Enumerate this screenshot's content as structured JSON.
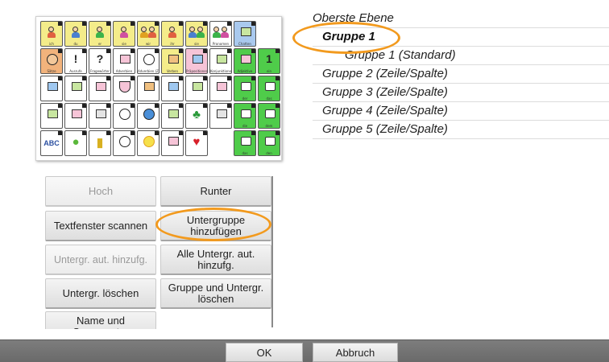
{
  "grid": {
    "rows": [
      [
        {
          "label": "ich",
          "color": "yellow",
          "icon": "person-icon"
        },
        {
          "label": "du",
          "color": "yellow",
          "icon": "person-pointing-icon"
        },
        {
          "label": "er",
          "color": "yellow",
          "icon": "boy-icon"
        },
        {
          "label": "sie",
          "color": "yellow",
          "icon": "girl-icon"
        },
        {
          "label": "wir",
          "color": "yellow",
          "icon": "group-icon"
        },
        {
          "label": "ihr",
          "color": "yellow",
          "icon": "pair-icon"
        },
        {
          "label": "sie",
          "color": "yellow",
          "icon": "people-icon"
        },
        {
          "label": "Pronomen",
          "color": "white",
          "icon": "people-group-icon"
        },
        {
          "label": "Chatten",
          "color": "blue",
          "icon": "speech-icon"
        },
        {
          "label": "",
          "color": "none",
          "icon": ""
        }
      ],
      [
        {
          "label": "Sätze",
          "color": "orange",
          "icon": "face-icon"
        },
        {
          "label": "Ausrufe",
          "color": "white",
          "icon": "exclamation-icon"
        },
        {
          "label": "Fragewörter",
          "color": "white",
          "icon": "question-icon"
        },
        {
          "label": "Adverbien",
          "color": "white",
          "icon": "tools-icon"
        },
        {
          "label": "Adverbien (Zeit)",
          "color": "white",
          "icon": "clock-icon"
        },
        {
          "label": "Verben",
          "color": "yellow",
          "icon": "action-icon"
        },
        {
          "label": "Präpositionen",
          "color": "pink",
          "icon": "box-icon"
        },
        {
          "label": "Konjunktionen",
          "color": "white",
          "icon": "magnet-icon"
        },
        {
          "label": "Adjektive",
          "color": "green",
          "icon": "adjective-icon"
        },
        {
          "label": "ein",
          "color": "green",
          "icon": "number-one-icon"
        }
      ],
      [
        {
          "label": "",
          "color": "white",
          "icon": "calendar-icon"
        },
        {
          "label": "",
          "color": "white",
          "icon": "bricks-icon"
        },
        {
          "label": "",
          "color": "white",
          "icon": "house-icon"
        },
        {
          "label": "",
          "color": "white",
          "icon": "bowl-icon"
        },
        {
          "label": "",
          "color": "white",
          "icon": "tv-icon"
        },
        {
          "label": "",
          "color": "white",
          "icon": "music-icon"
        },
        {
          "label": "",
          "color": "white",
          "icon": "nose-icon"
        },
        {
          "label": "",
          "color": "white",
          "icon": "toilet-icon"
        },
        {
          "label": "der",
          "color": "green",
          "icon": "article-icon"
        },
        {
          "label": "das",
          "color": "green",
          "icon": "article-icon"
        }
      ],
      [
        {
          "label": "",
          "color": "white",
          "icon": "dog-icon"
        },
        {
          "label": "",
          "color": "white",
          "icon": "car-icon"
        },
        {
          "label": "",
          "color": "white",
          "icon": "family-icon"
        },
        {
          "label": "",
          "color": "white",
          "icon": "clock-icon"
        },
        {
          "label": "",
          "color": "white",
          "icon": "globe-icon"
        },
        {
          "label": "",
          "color": "white",
          "icon": "puzzle-icon"
        },
        {
          "label": "",
          "color": "white",
          "icon": "tree-icon"
        },
        {
          "label": "",
          "color": "white",
          "icon": "clothes-icon"
        },
        {
          "label": "die",
          "color": "green",
          "icon": "article-icon"
        },
        {
          "label": "dem",
          "color": "green",
          "icon": "article-icon"
        }
      ],
      [
        {
          "label": "ABC",
          "color": "white",
          "icon": "abc-icon"
        },
        {
          "label": "",
          "color": "white",
          "icon": "apple-icon"
        },
        {
          "label": "",
          "color": "white",
          "icon": "bottle-icon"
        },
        {
          "label": "",
          "color": "white",
          "icon": "ball-icon"
        },
        {
          "label": "",
          "color": "white",
          "icon": "sun-icon"
        },
        {
          "label": "",
          "color": "white",
          "icon": "money-icon"
        },
        {
          "label": "",
          "color": "white",
          "icon": "heart-icon"
        },
        {
          "label": "",
          "color": "none",
          "icon": ""
        },
        {
          "label": "das",
          "color": "green",
          "icon": "article-icon"
        },
        {
          "label": "den",
          "color": "green",
          "icon": "article-icon"
        }
      ]
    ]
  },
  "buttons": {
    "up": "Hoch",
    "down": "Runter",
    "scan_textbox": "Textfenster scannen",
    "add_subgroup": "Untergruppe hinzufügen",
    "auto_add_subgroup": "Untergr. aut. hinzufg.",
    "auto_add_all_subgroups": "Alle Untergr. aut. hinzufg.",
    "delete_subgroup": "Untergr. löschen",
    "delete_group_and_subgroups": "Gruppe und Untergr. löschen",
    "name_and_scan_pattern": "Name und Scanmuster"
  },
  "tree": {
    "items": [
      {
        "label": "Oberste Ebene",
        "level": 0,
        "selected": false
      },
      {
        "label": "Gruppe 1",
        "level": 1,
        "selected": true
      },
      {
        "label": "Gruppe 1 (Standard)",
        "level": 2,
        "selected": false
      },
      {
        "label": "Gruppe 2 (Zeile/Spalte)",
        "level": 1,
        "selected": false
      },
      {
        "label": "Gruppe 3 (Zeile/Spalte)",
        "level": 1,
        "selected": false
      },
      {
        "label": "Gruppe 4 (Zeile/Spalte)",
        "level": 1,
        "selected": false
      },
      {
        "label": "Gruppe 5 (Zeile/Spalte)",
        "level": 1,
        "selected": false
      }
    ]
  },
  "footer": {
    "ok_label": "OK",
    "cancel_label": "Abbruch"
  },
  "colors": {
    "highlight": "#f29a1e",
    "cell_green": "#4fcc4a",
    "cell_yellow": "#f4ec8a",
    "bottom_bar": "#707070"
  }
}
